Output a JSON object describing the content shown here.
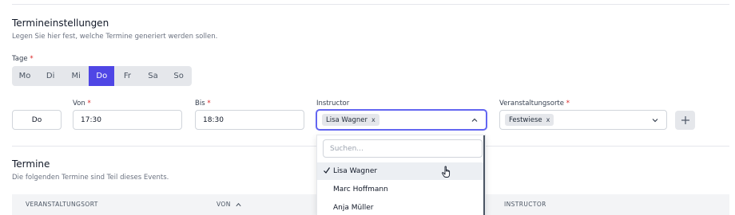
{
  "settings": {
    "title": "Termineinstellungen",
    "subtitle": "Legen Sie hier fest, welche Termine generiert werden sollen."
  },
  "days": {
    "label": "Tage",
    "required_mark": "*",
    "items": [
      "Mo",
      "Di",
      "Mi",
      "Do",
      "Fr",
      "Sa",
      "So"
    ],
    "selected": "Do"
  },
  "row": {
    "day_value": "Do",
    "from_label": "Von",
    "from_value": "17:30",
    "to_label": "Bis",
    "to_value": "18:30",
    "instructor_label": "Instructor",
    "instructor_chip": "Lisa Wagner",
    "venue_label": "Veranstaltungsorte",
    "venue_chip": "Festwiese",
    "required_mark": "*",
    "chip_remove": "x",
    "add_icon": "plus-icon"
  },
  "dropdown": {
    "search_placeholder": "Suchen...",
    "options": [
      "Lisa Wagner",
      "Marc Hoffmann",
      "Anja Müller"
    ],
    "selected": "Lisa Wagner"
  },
  "termine": {
    "title": "Termine",
    "subtitle": "Die folgenden Termine sind Teil dieses Events.",
    "columns": [
      "VERANSTALTUNGSORT",
      "VON",
      "INSTRUCTOR"
    ],
    "sort_icon": "chevron-up-icon"
  },
  "colors": {
    "accent": "#4f46e5",
    "required": "#dc2626"
  }
}
